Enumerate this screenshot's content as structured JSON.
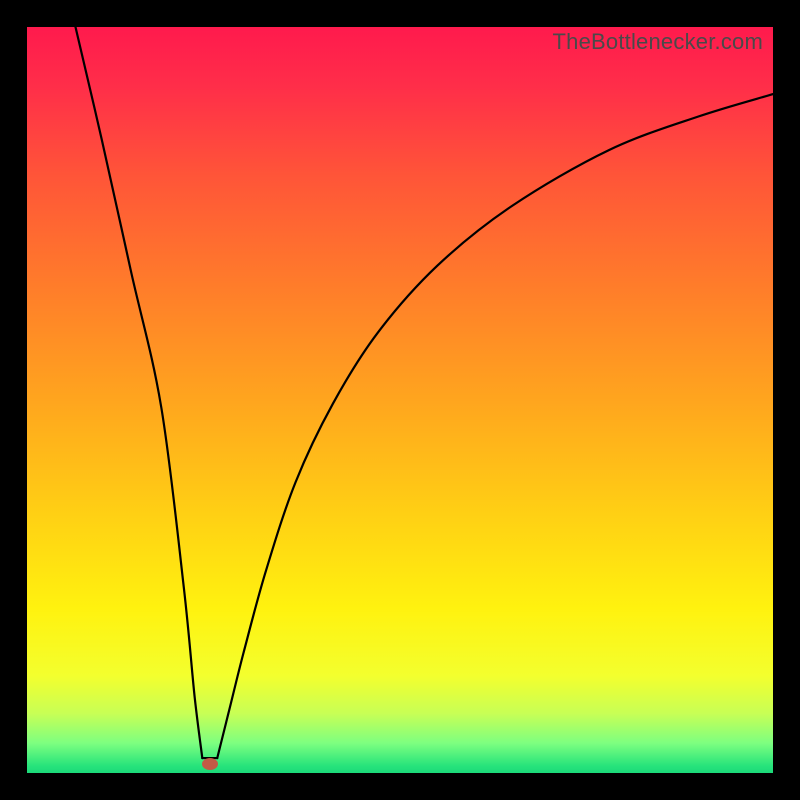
{
  "watermark": "TheBottlenecker.com",
  "marker": {
    "x_pct": 24.5,
    "y_pct": 98.8
  },
  "gradient_stops": [
    {
      "offset": 0,
      "color": "#ff1a4d"
    },
    {
      "offset": 0.08,
      "color": "#ff2e49"
    },
    {
      "offset": 0.2,
      "color": "#ff5538"
    },
    {
      "offset": 0.35,
      "color": "#ff7d2a"
    },
    {
      "offset": 0.5,
      "color": "#ffa51e"
    },
    {
      "offset": 0.65,
      "color": "#ffcf14"
    },
    {
      "offset": 0.78,
      "color": "#fff20f"
    },
    {
      "offset": 0.87,
      "color": "#f3ff2e"
    },
    {
      "offset": 0.92,
      "color": "#c8ff55"
    },
    {
      "offset": 0.96,
      "color": "#7dff80"
    },
    {
      "offset": 0.99,
      "color": "#28e47b"
    },
    {
      "offset": 1.0,
      "color": "#1bd97a"
    }
  ],
  "chart_data": {
    "type": "line",
    "title": "",
    "xlabel": "",
    "ylabel": "",
    "xlim_pct": [
      0,
      100
    ],
    "ylim_pct": [
      0,
      100
    ],
    "series": [
      {
        "name": "left-branch",
        "x_pct": [
          6.5,
          10,
          14,
          18,
          21,
          22.5,
          23.5
        ],
        "y_pct": [
          0,
          15,
          33,
          51,
          75,
          90,
          98
        ]
      },
      {
        "name": "right-branch",
        "x_pct": [
          25.5,
          27,
          29,
          32,
          36,
          41,
          47,
          55,
          65,
          78,
          90,
          100
        ],
        "y_pct": [
          98,
          92,
          84,
          73,
          61,
          50.5,
          41,
          32,
          24,
          16.5,
          12,
          9
        ]
      }
    ],
    "marker_point": {
      "x_pct": 24.5,
      "y_pct": 98.8
    }
  }
}
